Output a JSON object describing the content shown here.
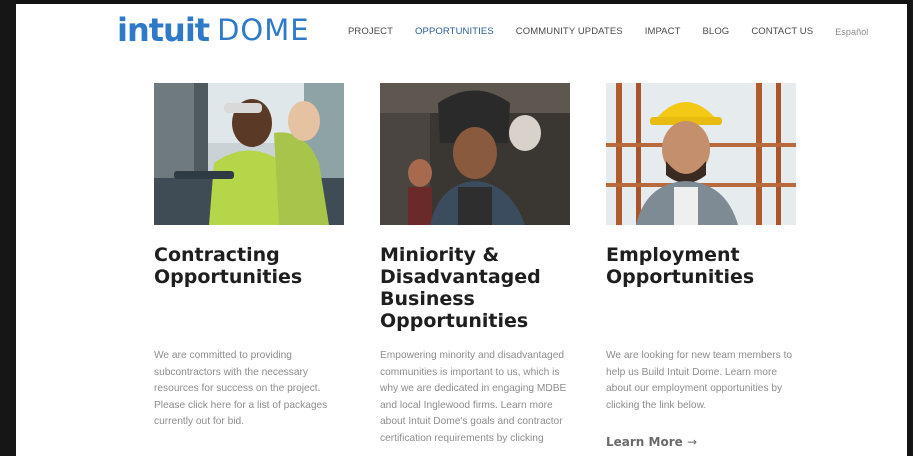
{
  "brand": {
    "name_primary": "intuit",
    "name_secondary": "DOME",
    "color": "#2f79c9"
  },
  "nav": {
    "items": [
      {
        "label": "PROJECT",
        "active": false
      },
      {
        "label": "OPPORTUNITIES",
        "active": true
      },
      {
        "label": "COMMUNITY UPDATES",
        "active": false
      },
      {
        "label": "IMPACT",
        "active": false
      },
      {
        "label": "BLOG",
        "active": false
      },
      {
        "label": "CONTACT US",
        "active": false
      }
    ],
    "language": "Español",
    "active_color": "#2b5c9a"
  },
  "cards": [
    {
      "title": "Contracting Opportunities",
      "description": "We are committed to providing subcontractors with the necessary resources for success on the project. Please click here for a list of packages currently out for bid.",
      "photo": "worker-in-truck-photo"
    },
    {
      "title": "Miniority & Disadvantaged Business Opportunities",
      "description": "Empowering minority and disadvantaged communities is important to us, which is why we are dedicated in engaging MDBE and local Inglewood firms. Learn more about Intuit Dome's goals and contractor certification requirements by clicking",
      "photo": "welder-woman-photo"
    },
    {
      "title": "Employment Opportunities",
      "description": "We are looking for new team members to help us Build Intuit Dome. Learn more about our employment opportunities by clicking the link below.",
      "photo": "construction-worker-hardhat-photo",
      "link": "Learn More",
      "link_arrow": "→"
    }
  ]
}
